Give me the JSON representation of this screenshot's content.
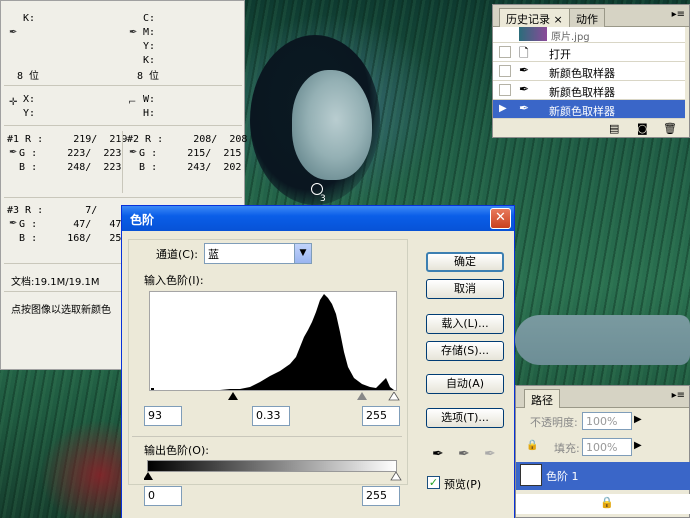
{
  "info_panel": {
    "k_label": "K:",
    "c_label": "C:",
    "m_label": "M:",
    "y_label": "Y:",
    "k2_label": "K:",
    "bit_left": "8 位",
    "bit_right": "8 位",
    "x_label": "X:",
    "y2_label": "Y:",
    "w_label": "W:",
    "h_label": "H:",
    "s1": {
      "r": "#1 R :     219/  219",
      "g": "  G :     223/  223",
      "b": "  B :     248/  223"
    },
    "s2": {
      "r": "#2 R :     208/  208",
      "g": "  G :     215/  215",
      "b": "  B :     243/  202"
    },
    "s3": {
      "r": "#3 R :       7/    7",
      "g": "  G :      47/   47",
      "b": "  B :     168/   25"
    },
    "doc_size": "文档:19.1M/19.1M",
    "hint": "点按图像以选取新颜色"
  },
  "history_panel": {
    "tab_history": "历史记录",
    "tab_history_close": "×",
    "tab_actions": "动作",
    "snapshot_name": "原片.jpg",
    "items": [
      {
        "label": "打开"
      },
      {
        "label": "新颜色取样器"
      },
      {
        "label": "新颜色取样器"
      },
      {
        "label": "新颜色取样器"
      }
    ]
  },
  "levels_dialog": {
    "title": "色阶",
    "channel_label": "通道(C):",
    "channel_value": "蓝",
    "input_levels_label": "输入色阶(I):",
    "input_black": "93",
    "input_gamma": "0.33",
    "input_white": "255",
    "output_levels_label": "输出色阶(O):",
    "output_black": "0",
    "output_white": "255",
    "btn_ok": "确定",
    "btn_cancel": "取消",
    "btn_load": "载入(L)...",
    "btn_save": "存储(S)...",
    "btn_auto": "自动(A)",
    "btn_options": "选项(T)...",
    "preview_label": "预览(P)",
    "preview_checked": true
  },
  "layers_panel": {
    "tab_paths": "路径",
    "opacity_label": "不透明度:",
    "opacity_value": "100%",
    "fill_label": "填充:",
    "fill_value": "100%",
    "layer_name": "色阶 1"
  },
  "colors": {
    "selection_blue": "#3a66c8",
    "titlebar_blue": "#0a5ee8"
  }
}
